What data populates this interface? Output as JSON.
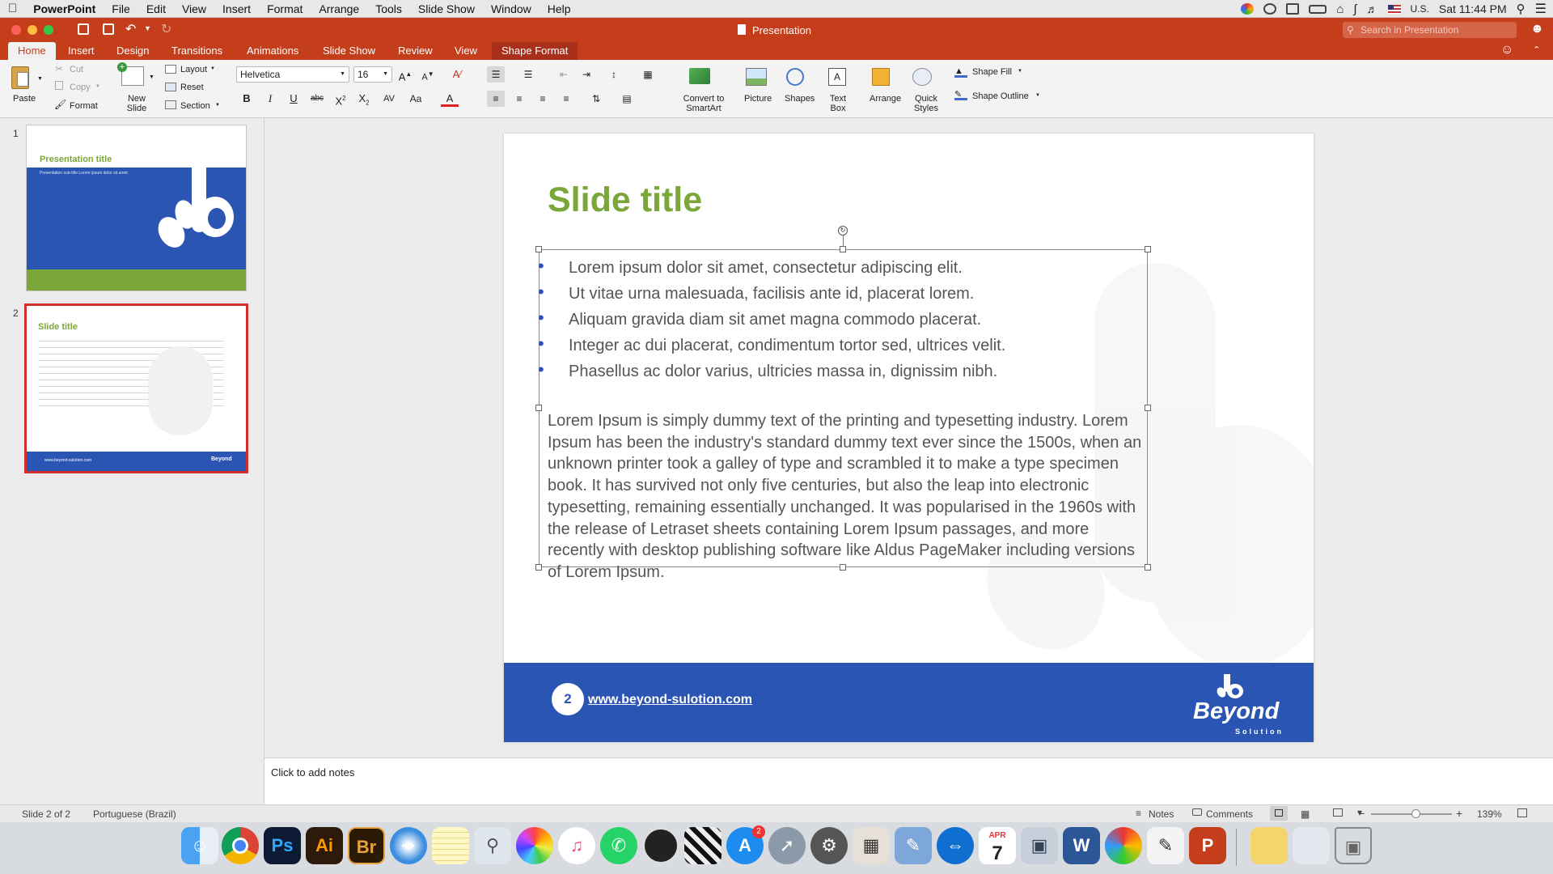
{
  "menubar": {
    "apple": "",
    "app": "PowerPoint",
    "items": [
      "File",
      "Edit",
      "View",
      "Insert",
      "Format",
      "Arrange",
      "Tools",
      "Slide Show",
      "Window",
      "Help"
    ],
    "input_source": "U.S.",
    "clock": "Sat 11:44 PM"
  },
  "window": {
    "title": "Presentation",
    "search_placeholder": "Search in Presentation"
  },
  "tabs": [
    "Home",
    "Insert",
    "Design",
    "Transitions",
    "Animations",
    "Slide Show",
    "Review",
    "View",
    "Shape Format"
  ],
  "ribbon": {
    "paste": "Paste",
    "cut": "Cut",
    "copy": "Copy",
    "format": "Format",
    "new_slide": "New Slide",
    "layout": "Layout",
    "reset": "Reset",
    "section": "Section",
    "font_name": "Helvetica",
    "font_size": "16",
    "convert_smartart": "Convert to SmartArt",
    "picture": "Picture",
    "shapes": "Shapes",
    "text_box": "Text Box",
    "arrange": "Arrange",
    "quick_styles": "Quick Styles",
    "shape_fill": "Shape Fill",
    "shape_outline": "Shape Outline"
  },
  "thumbnails": [
    {
      "num": "1",
      "title": "Presentation title",
      "subtitle": "Presentation sub-title Lorem ipsum dolor sit amet."
    },
    {
      "num": "2",
      "title": "Slide title",
      "footer": "www.beyond-sulotion.com",
      "logo": "Beyond"
    }
  ],
  "slide": {
    "title": "Slide title",
    "bullets": [
      "Lorem ipsum dolor sit amet, consectetur adipiscing elit.",
      "Ut vitae urna malesuada, facilisis ante id, placerat lorem.",
      "Aliquam gravida diam sit amet magna commodo placerat.",
      "Integer ac dui placerat, condimentum tortor sed, ultrices velit.",
      "Phasellus ac dolor varius, ultricies massa in, dignissim nibh."
    ],
    "paragraph": "Lorem Ipsum is simply dummy text of the printing and typesetting industry. Lorem Ipsum has been the industry's standard dummy text ever since the 1500s, when an unknown printer took a galley of type and scrambled it to make a type specimen book. It has survived not only five centuries, but also the leap into electronic typesetting, remaining essentially unchanged. It was popularised in the 1960s with the release of Letraset sheets containing Lorem Ipsum passages, and more recently with desktop publishing software like Aldus PageMaker including versions of Lorem Ipsum.",
    "page_number": "2",
    "website": "www.beyond-sulotion.com",
    "logo_text": "Beyond",
    "logo_sub": "Solution"
  },
  "notes_placeholder": "Click to add notes",
  "status": {
    "slide_pos": "Slide 2 of 2",
    "language": "Portuguese (Brazil)",
    "notes": "Notes",
    "comments": "Comments",
    "zoom": "139%"
  },
  "dock": {
    "calendar_month": "APR",
    "calendar_day": "7",
    "appstore_badge": "2"
  },
  "colors": {
    "accent": "#c43e1c",
    "slide_blue": "#2a55b2",
    "title_green": "#7aa63a"
  }
}
